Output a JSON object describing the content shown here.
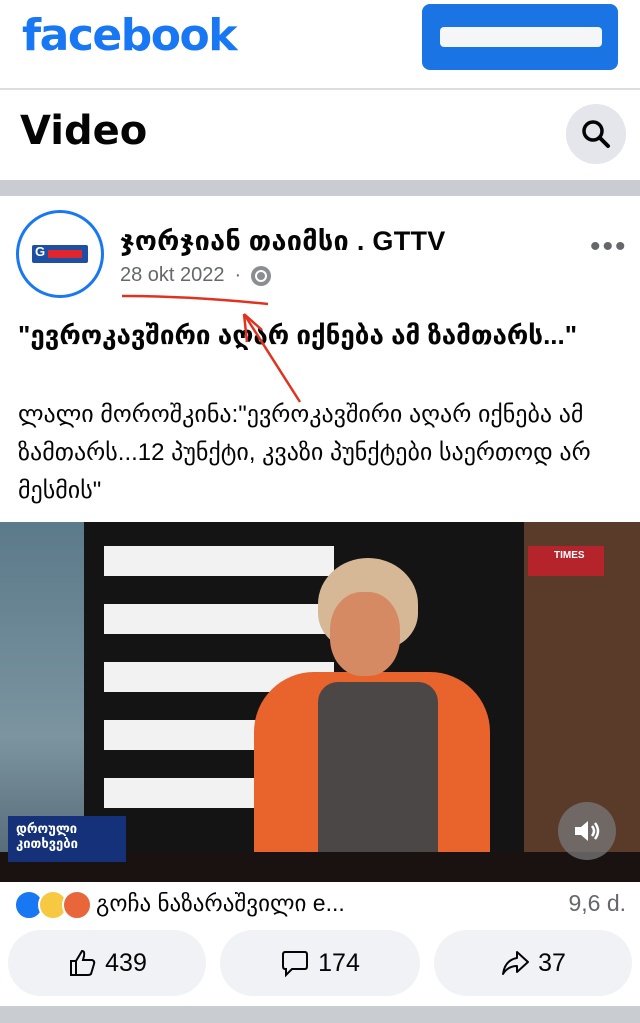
{
  "app": {
    "logo_text": "facebook",
    "brand_color": "#1877f2"
  },
  "header": {
    "title": "Video"
  },
  "post": {
    "page_name": "ჯორჯიან თაიმსი . GTTV",
    "date": "28 okt 2022",
    "separator": "·",
    "title": "\"ევროკავშირი აღარ იქნება ამ ზამთარს...\"",
    "body": "ლალი მოროშკინა:\"ევროკავშირი აღარ იქნება ამ ზამთარს...12 პუნქტი, კვაზი პუნქტები საერთოდ არ მესმის\"",
    "avatar_text": "G"
  },
  "video": {
    "channel_logo": "TIMES",
    "lower_third": "დროული კითხვები"
  },
  "reactions": {
    "text": "გოჩა ნაზარაშვილი e...",
    "views": "9,6 d."
  },
  "actions": {
    "likes": "439",
    "comments": "174",
    "shares": "37"
  }
}
